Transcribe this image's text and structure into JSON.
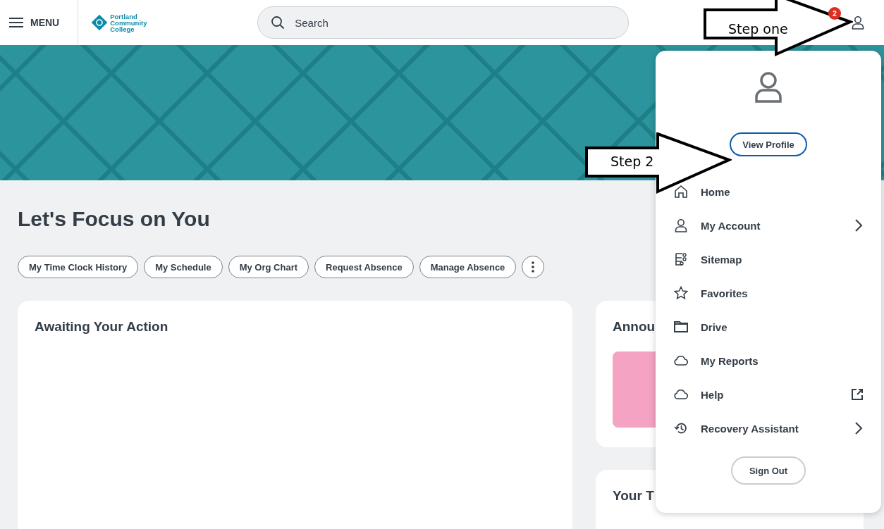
{
  "header": {
    "menu_label": "MENU",
    "logo_lines": [
      "Portland",
      "Community",
      "College"
    ],
    "search": {
      "placeholder": "Search"
    },
    "notification_count": "2"
  },
  "page": {
    "title": "Let's Focus on You",
    "quick_links": [
      "My Time Clock History",
      "My Schedule",
      "My Org Chart",
      "Request Absence",
      "Manage Absence"
    ],
    "cards": [
      {
        "title": "Awaiting Your Action",
        "kind": "plain"
      },
      {
        "title": "Annou",
        "kind": "photo"
      },
      {
        "title": "Your T",
        "kind": "plain"
      }
    ]
  },
  "profile_menu": {
    "view_profile": "View Profile",
    "items": [
      {
        "label": "Home",
        "kind": "link"
      },
      {
        "label": "My Account",
        "kind": "submenu"
      },
      {
        "label": "Sitemap",
        "kind": "link"
      },
      {
        "label": "Favorites",
        "kind": "link"
      },
      {
        "label": "Drive",
        "kind": "link"
      },
      {
        "label": "My Reports",
        "kind": "link"
      },
      {
        "label": "Help",
        "kind": "external"
      },
      {
        "label": "Recovery Assistant",
        "kind": "submenu"
      }
    ],
    "sign_out": "Sign Out"
  },
  "annotations": [
    "Step one",
    "Step 2"
  ]
}
